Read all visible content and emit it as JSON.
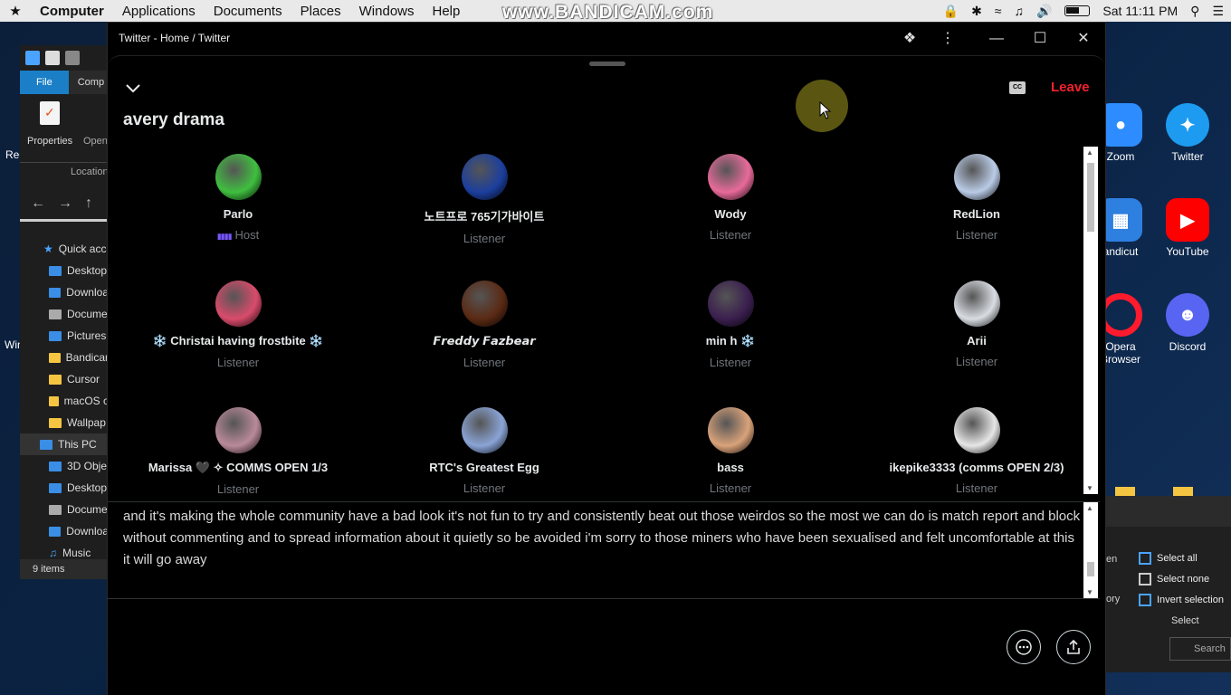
{
  "menubar": {
    "app_name": "Computer",
    "menus": [
      "Applications",
      "Documents",
      "Places",
      "Windows",
      "Help"
    ],
    "watermark": "www.BANDICAM.com",
    "clock": "Sat 11:11 PM"
  },
  "explorer": {
    "tab_file": "File",
    "tab_computer": "Comp",
    "properties_label": "Properties",
    "open_label": "Open",
    "location_label": "Location",
    "quick_access": "Quick acc",
    "quick_items": [
      "Desktop",
      "Downloa",
      "Docume",
      "Pictures",
      "Bandicar",
      "Cursor",
      "macOS c",
      "Wallpap"
    ],
    "this_pc": "This PC",
    "pc_items": [
      "3D Obje",
      "Desktop",
      "Docume",
      "Downloa",
      "Music"
    ],
    "status": "9 items"
  },
  "desktop_icons": {
    "zoom": "Zoom",
    "twitter": "Twitter",
    "bandicut": "andicut",
    "youtube": "YouTube",
    "opera_1": "Opera",
    "opera_2": "Browser",
    "discord": "Discord"
  },
  "desktop_left_labels": {
    "rec": "Rec",
    "win": "Win"
  },
  "right_explorer": {
    "select_all": "Select all",
    "select_none": "Select none",
    "invert_selection": "Invert selection",
    "group_label": "Select",
    "search_placeholder": "Search",
    "frag_en": "en",
    "frag_ory": "ory"
  },
  "window": {
    "title": "Twitter - Home / Twitter",
    "leave_label": "Leave",
    "cc_label": "CC",
    "space_title": "avery drama"
  },
  "participants": [
    {
      "name": "Parlo",
      "role": "Host",
      "avatar_color": "#3fbf3f"
    },
    {
      "name": "노트프로 765기가바이트",
      "role": "Listener",
      "avatar_color": "#1c3f9e"
    },
    {
      "name": "Wody",
      "role": "Listener",
      "avatar_color": "#e86a9a"
    },
    {
      "name": "RedLion",
      "role": "Listener",
      "avatar_color": "#b9cbe6"
    },
    {
      "name": "❄️ Christai having frostbite ❄️",
      "role": "Listener",
      "avatar_color": "#d94b6b"
    },
    {
      "name": "𝙁𝙧𝙚𝙙𝙙𝙮 𝙁𝙖𝙯𝙗𝙚𝙖𝙧",
      "role": "Listener",
      "avatar_color": "#5a2a14"
    },
    {
      "name": "min h ❄️",
      "role": "Listener",
      "avatar_color": "#3b1f4f"
    },
    {
      "name": "Arii",
      "role": "Listener",
      "avatar_color": "#d9dde3"
    },
    {
      "name": "Marissa 🖤 ✧ COMMS OPEN 1/3",
      "role": "Listener",
      "avatar_color": "#b98a9a"
    },
    {
      "name": "RTC's Greatest Egg",
      "role": "Listener",
      "avatar_color": "#8aa4d6"
    },
    {
      "name": "bass",
      "role": "Listener",
      "avatar_color": "#d9a27a"
    },
    {
      "name": "ikepike3333 (comms OPEN 2/3)",
      "role": "Listener",
      "avatar_color": "#e6e6e6"
    }
  ],
  "caption": "and it's making the whole community have a bad look it's not fun to try and consistently beat out those weirdos so the most we can do is match report and block without commenting and to spread information about it quietly so be avoided i'm sorry to those miners who have been sexualised and felt uncomfortable at this it will go away",
  "colors": {
    "leave": "#f4212e",
    "host_accent": "#7856ff",
    "muted_text": "#71767b"
  }
}
